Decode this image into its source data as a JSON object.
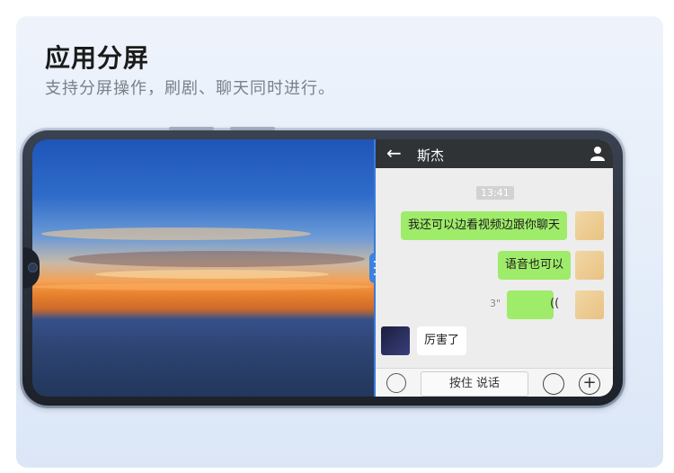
{
  "header": {
    "title": "应用分屏",
    "subtitle": "支持分屏操作，刷剧、聊天同时进行。"
  },
  "chat": {
    "contact_name": "斯杰",
    "back_icon": "arrow-left-icon",
    "profile_icon": "person-icon",
    "timestamp": "13:41",
    "messages": [
      {
        "from": "me",
        "text": "我还可以边看视频边跟你聊天"
      },
      {
        "from": "me",
        "text": "语音也可以"
      },
      {
        "from": "me",
        "type": "voice",
        "duration": "3\""
      },
      {
        "from": "other",
        "text": "厉害了"
      }
    ],
    "input": {
      "keyboard_icon": "keyboard-icon",
      "hold_to_talk": "按住 说话",
      "emoji_icon": "emoji-icon",
      "plus_icon": "plus-icon"
    }
  },
  "colors": {
    "accent": "#3b83e0",
    "chat_bubble_me": "#9feb6a",
    "chat_header": "#2f3336"
  }
}
